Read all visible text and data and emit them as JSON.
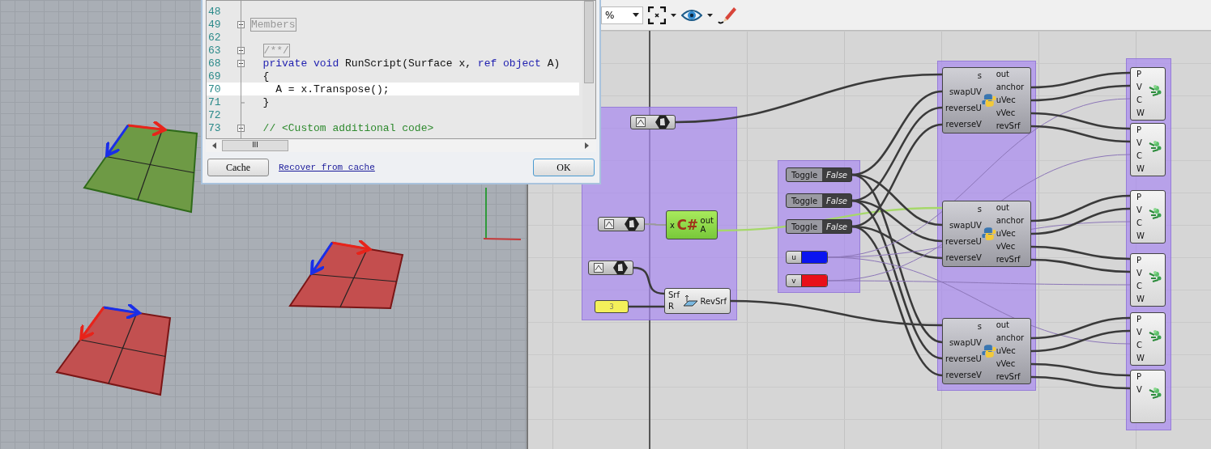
{
  "viewport": {
    "surfaces": [
      {
        "color": "#6e9a45",
        "transposed": false
      },
      {
        "color": "#c44e4e",
        "transposed": false
      },
      {
        "color": "#c25050",
        "transposed": true
      }
    ]
  },
  "editor": {
    "lines": [
      {
        "number": "48",
        "kind": "plain",
        "current": false
      },
      {
        "number": "49",
        "kind": "expandable",
        "current": false,
        "tokens": [
          {
            "text": "Members",
            "kind": "folded"
          }
        ]
      },
      {
        "number": "62",
        "kind": "plain",
        "current": false
      },
      {
        "number": "63",
        "kind": "expandable",
        "current": false,
        "tokens": [
          {
            "text": "  /**/",
            "kind": "folded"
          }
        ]
      },
      {
        "number": "68",
        "kind": "collapsible",
        "current": false,
        "tokens": [
          {
            "text": "  private void ",
            "kind": "keyword"
          },
          {
            "text": "RunScript(Surface x, ",
            "kind": "plain"
          },
          {
            "text": "ref object ",
            "kind": "keyword"
          },
          {
            "text": "A)",
            "kind": "plain"
          }
        ]
      },
      {
        "number": "69",
        "kind": "plain",
        "current": false,
        "tokens": [
          {
            "text": "  {",
            "kind": "plain"
          }
        ]
      },
      {
        "number": "70",
        "kind": "plain",
        "current": true,
        "tokens": [
          {
            "text": "    A = x.Transpose();",
            "kind": "plain"
          }
        ]
      },
      {
        "number": "71",
        "kind": "fold_end",
        "current": false,
        "tokens": [
          {
            "text": "  }",
            "kind": "plain"
          }
        ]
      },
      {
        "number": "72",
        "kind": "plain",
        "current": false
      },
      {
        "number": "73",
        "kind": "collapsible",
        "current": false,
        "tokens": [
          {
            "text": "  // <Custom additional code>",
            "kind": "comment"
          }
        ]
      }
    ],
    "scroll_grip": "III",
    "cache_button": "Cache",
    "recover_link": "Recover from cache",
    "ok_button": "OK"
  },
  "toolbar": {
    "zoom_value": "%"
  },
  "canvas": {
    "script_node": {
      "icon_text": "C#",
      "inputs": [
        "x"
      ],
      "outputs": [
        "out",
        "A"
      ]
    },
    "slider": {
      "value": "3"
    },
    "revolve_node": {
      "inputs": [
        "Srf",
        "R"
      ],
      "output": "RevSrf"
    },
    "toggles": [
      {
        "label": "Toggle",
        "value": "False"
      },
      {
        "label": "Toggle",
        "value": "False"
      },
      {
        "label": "Toggle",
        "value": "False"
      }
    ],
    "swatches": [
      {
        "label": "u",
        "color": "#0a14f0"
      },
      {
        "label": "v",
        "color": "#e8101a"
      }
    ],
    "python_nodes": [
      {
        "inputs": [
          "s",
          "swapUV",
          "reverseU",
          "reverseV"
        ],
        "outputs": [
          "out",
          "anchor",
          "uVec",
          "vVec",
          "revSrf"
        ]
      },
      {
        "inputs": [
          "s",
          "swapUV",
          "reverseU",
          "reverseV"
        ],
        "outputs": [
          "out",
          "anchor",
          "uVec",
          "vVec",
          "revSrf"
        ]
      },
      {
        "inputs": [
          "s",
          "swapUV",
          "reverseU",
          "reverseV"
        ],
        "outputs": [
          "out",
          "anchor",
          "uVec",
          "vVec",
          "revSrf"
        ]
      }
    ],
    "vector_nodes": [
      {
        "inputs": [
          "P",
          "V",
          "C",
          "W"
        ]
      },
      {
        "inputs": [
          "P",
          "V",
          "C",
          "W"
        ]
      },
      {
        "inputs": [
          "P",
          "V",
          "C",
          "W"
        ]
      },
      {
        "inputs": [
          "P",
          "V",
          "C",
          "W"
        ]
      },
      {
        "inputs": [
          "P",
          "V",
          "C",
          "W"
        ]
      },
      {
        "inputs": [
          "P",
          "V"
        ]
      }
    ]
  }
}
